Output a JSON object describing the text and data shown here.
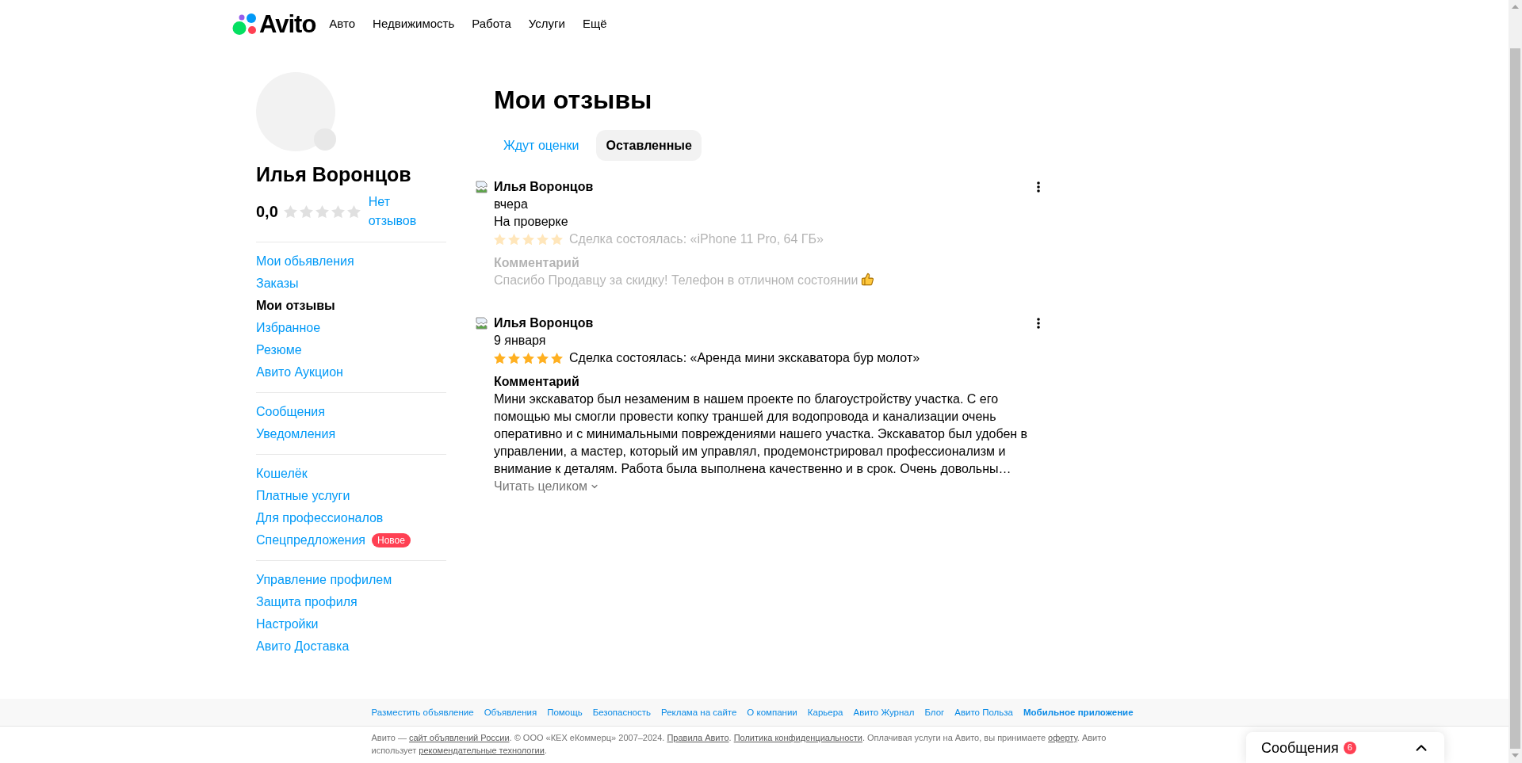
{
  "header": {
    "logo": "Avito",
    "nav": [
      "Авто",
      "Недвижимость",
      "Работа",
      "Услуги",
      "Ещё"
    ]
  },
  "profile": {
    "name": "Илья Воронцов",
    "rating": "0,0",
    "stars": 0,
    "reviews_link": "Нет отзывов"
  },
  "sidebar": {
    "groups": [
      {
        "items": [
          {
            "label": "Мои обьявления",
            "selected": false
          },
          {
            "label": "Заказы",
            "selected": false
          },
          {
            "label": "Мои отзывы",
            "selected": true
          },
          {
            "label": "Избранное",
            "selected": false
          },
          {
            "label": "Резюме",
            "selected": false
          },
          {
            "label": "Авито Аукцион",
            "selected": false
          }
        ]
      },
      {
        "items": [
          {
            "label": "Сообщения",
            "selected": false
          },
          {
            "label": "Уведомления",
            "selected": false
          }
        ]
      },
      {
        "items": [
          {
            "label": "Кошелёк",
            "selected": false
          },
          {
            "label": "Платные услуги",
            "selected": false
          },
          {
            "label": "Для профессионалов",
            "selected": false
          },
          {
            "label": "Спецпредложения",
            "selected": false,
            "badge": "Новое"
          }
        ]
      },
      {
        "items": [
          {
            "label": "Управление профилем",
            "selected": false
          },
          {
            "label": "Защита профиля",
            "selected": false
          },
          {
            "label": "Настройки",
            "selected": false
          },
          {
            "label": "Авито Доставка",
            "selected": false
          }
        ]
      }
    ]
  },
  "page": {
    "title": "Мои отзывы"
  },
  "tabs": [
    {
      "label": "Ждут оценки",
      "selected": false
    },
    {
      "label": "Оставленные",
      "selected": true
    }
  ],
  "reviews": [
    {
      "author": "Илья Воронцов",
      "date": "вчера",
      "status": "На проверке",
      "pending": true,
      "stars": 5,
      "deal": "Сделка состоялась: «iPhone 11 Pro, 64 ГБ»",
      "comment_label": "Комментарий",
      "comment": "Спасибо Продавцу за скидку! Телефон в отличном состоянии",
      "has_emoji": true
    },
    {
      "author": "Илья Воронцов",
      "date": "9 января",
      "pending": false,
      "stars": 5,
      "deal": "Сделка состоялась: «Аренда мини экскаватора бур молот»",
      "comment_label": "Комментарий",
      "comment": "Мини экскаватор был незаменим в нашем проекте по благоустройству участка. С его помощью мы смогли провести копку траншей для водопровода и канализации очень оперативно и с минимальными повреждениями нашего участка. Экскаватор был удобен в управлении, а мастер, который им управлял, продемонстрировал профессионализм и внимание к деталям. Работа была выполнена качественно и в срок. Очень довольны…",
      "has_emoji": false,
      "read_more": "Читать целиком"
    }
  ],
  "footer": {
    "links": [
      {
        "label": "Разместить объявление",
        "bold": false
      },
      {
        "label": "Объявления",
        "bold": false
      },
      {
        "label": "Помощь",
        "bold": false
      },
      {
        "label": "Безопасность",
        "bold": false
      },
      {
        "label": "Реклама на сайте",
        "bold": false
      },
      {
        "label": "О компании",
        "bold": false
      },
      {
        "label": "Карьера",
        "bold": false
      },
      {
        "label": "Авито Журнал",
        "bold": false
      },
      {
        "label": "Блог",
        "bold": false
      },
      {
        "label": "Авито Польза",
        "bold": false
      },
      {
        "label": "Мобильное приложение",
        "bold": true
      }
    ],
    "copyright": [
      {
        "kind": "text",
        "text": "Авито — "
      },
      {
        "kind": "link",
        "text": "сайт объявлений России"
      },
      {
        "kind": "text",
        "text": ". © ООО «КЕХ еКоммерц» 2007–2024. "
      },
      {
        "kind": "link",
        "text": "Правила Авито"
      },
      {
        "kind": "text",
        "text": ". "
      },
      {
        "kind": "link",
        "text": "Политика конфиденциальности"
      },
      {
        "kind": "text",
        "text": ". Оплачивая услуги на Авито, вы принимаете "
      },
      {
        "kind": "link",
        "text": "оферту"
      },
      {
        "kind": "text",
        "text": ". Авито использует "
      },
      {
        "kind": "link",
        "text": "рекомендательные технологии"
      },
      {
        "kind": "text",
        "text": "."
      }
    ]
  },
  "messages": {
    "title": "Сообщения",
    "count": "6",
    "expanded": false
  }
}
